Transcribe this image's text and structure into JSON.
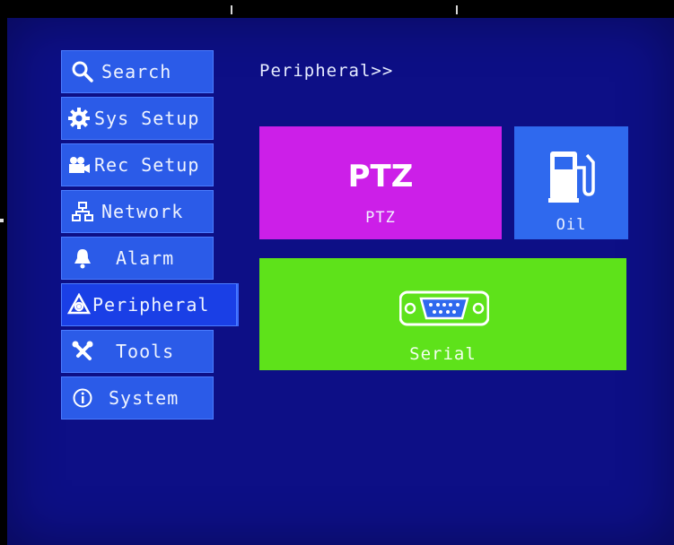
{
  "menu": {
    "items": [
      {
        "label": "Search",
        "icon": "search-icon"
      },
      {
        "label": "Sys Setup",
        "icon": "gear-icon"
      },
      {
        "label": "Rec Setup",
        "icon": "camera-icon"
      },
      {
        "label": "Network",
        "icon": "network-icon"
      },
      {
        "label": "Alarm",
        "icon": "bell-icon"
      },
      {
        "label": "Peripheral",
        "icon": "peripheral-icon"
      },
      {
        "label": "Tools",
        "icon": "tools-icon"
      },
      {
        "label": "System",
        "icon": "info-icon"
      }
    ],
    "active": "Peripheral"
  },
  "header": {
    "breadcrumb": "Peripheral>>"
  },
  "tiles": {
    "ptz": {
      "big": "PTZ",
      "caption": "PTZ"
    },
    "oil": {
      "caption": "Oil",
      "icon": "fuel-pump-icon"
    },
    "serial": {
      "caption": "Serial",
      "icon": "serial-port-icon"
    }
  },
  "colors": {
    "background": "#0d0f86",
    "menu": "#2b5be8",
    "ptz": "#cc1fe8",
    "oil": "#2f69ee",
    "serial": "#5ee21a"
  }
}
